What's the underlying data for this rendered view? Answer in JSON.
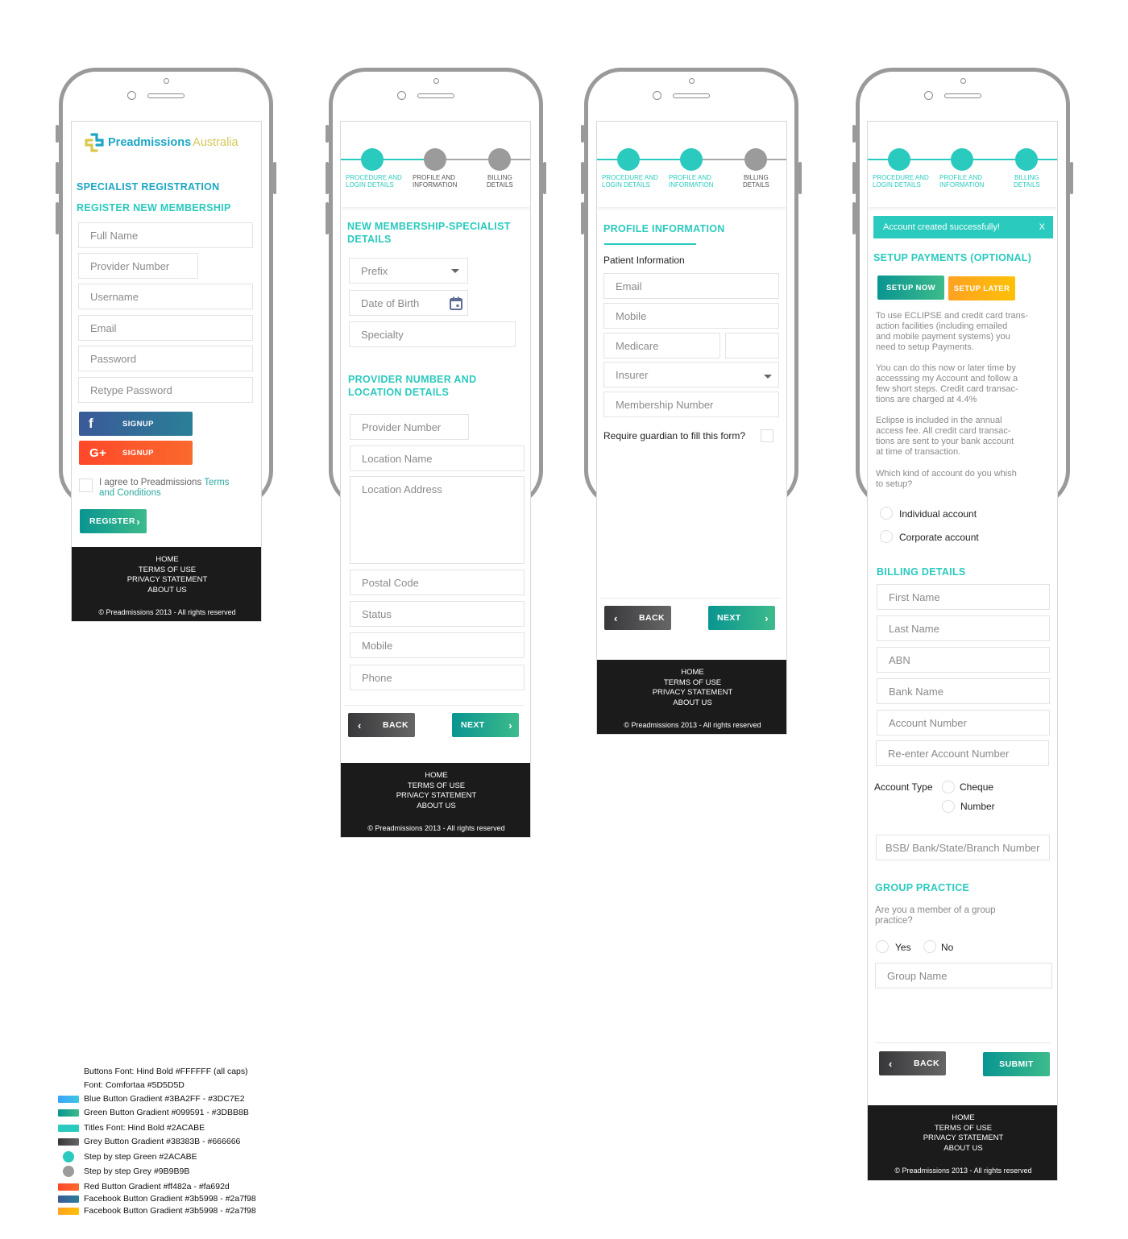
{
  "brand": {
    "logo_main": "Preadmissions",
    "logo_accent": "Australia",
    "colors": {
      "titles": "#2ACABE",
      "step_green": "#2ACABE",
      "step_grey": "#9B9B9B",
      "body_font": "#5D5D5D",
      "green_from": "#099591",
      "green_to": "#3DBB8B",
      "grey_from": "#38383B",
      "grey_to": "#666666",
      "red_from": "#ff482a",
      "red_to": "#fa692d",
      "facebook_from": "#3b5998",
      "facebook_to": "#2a7f98"
    }
  },
  "footer": {
    "links": [
      "HOME",
      "TERMS OF USE",
      "PRIVACY STATEMENT",
      "ABOUT US"
    ],
    "copyright": "© Preadmissions 2013 - All rights reserved"
  },
  "steps": {
    "labels": [
      [
        "PROCEDURE AND",
        "LOGIN DETAILS"
      ],
      [
        "PROFILE AND",
        "INFORMATION"
      ],
      [
        "BILLING",
        "DETAILS"
      ]
    ]
  },
  "screen1": {
    "title": "SPECIALIST REGISTRATION",
    "subtitle": "REGISTER NEW MEMBERSHIP",
    "fields": [
      "Full Name",
      "Provider Number",
      "Username",
      "Email",
      "Password",
      "Retype Password"
    ],
    "facebook_signup": "SIGNUP",
    "google_signup": "SIGNUP",
    "facebook_glyph": "f",
    "google_glyph": "G+",
    "agree_text": "I agree to Preadmissions",
    "terms_link_1": "Terms",
    "terms_link_2": "and Conditions",
    "register_label": "REGISTER"
  },
  "screen2": {
    "active_step": 1,
    "title_1": "NEW MEMBERSHIP-SPECIALIST",
    "title_2": "DETAILS",
    "prefix": "Prefix",
    "dob": "Date of Birth",
    "specialty": "Specialty",
    "section2_1": "PROVIDER NUMBER AND",
    "section2_2": "LOCATION DETAILS",
    "fields": [
      "Provider Number",
      "Location Name",
      "Location Address",
      "Postal Code",
      "Status",
      "Mobile",
      "Phone"
    ],
    "back_label": "BACK",
    "next_label": "NEXT"
  },
  "screen3": {
    "active_step": 2,
    "title": "PROFILE INFORMATION",
    "subtitle": "Patient Information",
    "fields": [
      "Email",
      "Mobile",
      "Medicare",
      "",
      "Insurer",
      "Membership Number"
    ],
    "guardian_label": "Require guardian to fill this form?",
    "back_label": "BACK",
    "next_label": "NEXT"
  },
  "screen4": {
    "active_step": 3,
    "alert": "Account created successfully!",
    "alert_close": "X",
    "title": "SETUP PAYMENTS (OPTIONAL)",
    "setup_now": "SETUP NOW",
    "setup_later": "SETUP LATER",
    "para1": [
      "To use ECLIPSE and credit card trans-",
      "action facilities (including emailed",
      "and mobile payment systems) you",
      "need to setup Payments."
    ],
    "para2": [
      "You can do this now or later time by",
      "accesssing my Account and follow a",
      "few short steps. Credit card transac-",
      "tions are charged at 4.4%"
    ],
    "para3": [
      "Eclipse is included in the annual",
      "access fee.  All credit card transac-",
      "tions are sent to your bank account",
      "at time of transaction."
    ],
    "para4": [
      "Which kind of account do you whish",
      "to setup?"
    ],
    "account_options": [
      "Individual account",
      "Corporate account"
    ],
    "billing_title": "BILLING DETAILS",
    "billing_fields": [
      "First Name",
      "Last Name",
      "ABN",
      "Bank Name",
      "Account Number",
      "Re-enter Account Number"
    ],
    "account_type_label": "Account Type",
    "account_type_options": [
      "Cheque",
      "Number"
    ],
    "bsb": "BSB/ Bank/State/Branch Number",
    "group_title": "GROUP PRACTICE",
    "group_question": [
      "Are you a member of a group",
      "practice?"
    ],
    "group_options": [
      "Yes",
      "No"
    ],
    "group_name": "Group Name",
    "back_label": "BACK",
    "submit_label": "SUBMIT"
  },
  "legend": {
    "rows": [
      "Buttons Font: Hind Bold #FFFFFF (all caps)",
      "Font: Comfortaa #5D5D5D",
      "Blue Button Gradient #3BA2FF - #3DC7E2",
      "Green Button Gradient #099591 - #3DBB8B",
      "Titles Font: Hind Bold #2ACABE",
      "Grey Button Gradient #38383B - #666666",
      "Step by step Green #2ACABE",
      "Step by step Grey #9B9B9B",
      "Red Button Gradient #ff482a - #fa692d",
      "Facebook Button Gradient #3b5998 - #2a7f98",
      "Facebook Button Gradient #3b5998 - #2a7f98"
    ]
  }
}
